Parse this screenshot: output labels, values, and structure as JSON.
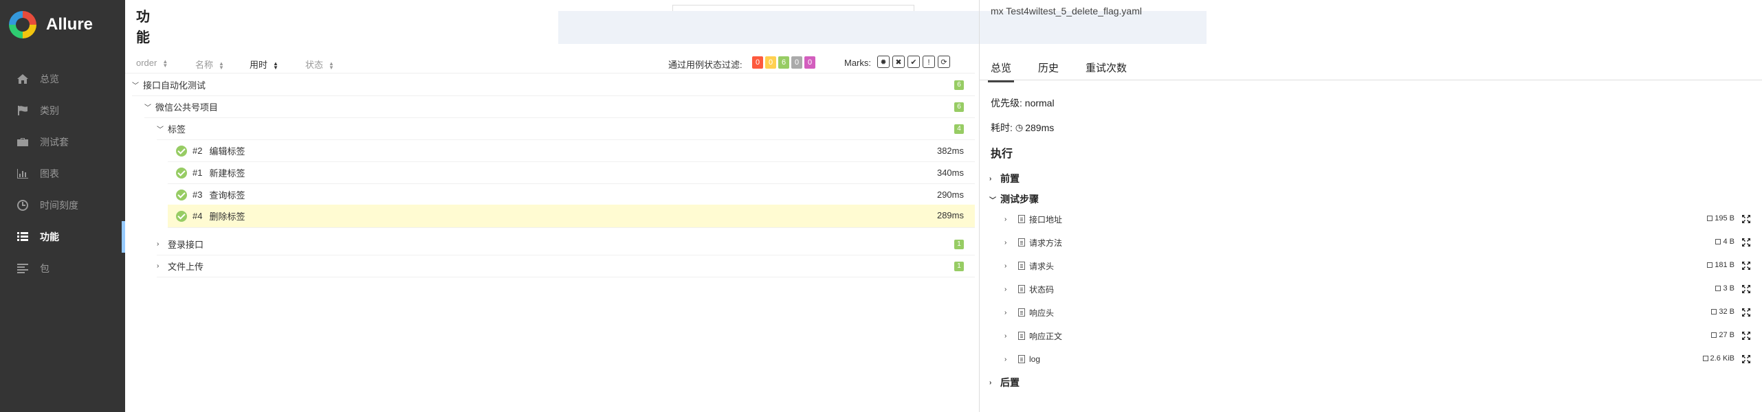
{
  "app": {
    "name": "Allure"
  },
  "sidebar": {
    "items": [
      {
        "label": "总览",
        "icon": "home-icon"
      },
      {
        "label": "类别",
        "icon": "flag-icon"
      },
      {
        "label": "测试套",
        "icon": "briefcase-icon"
      },
      {
        "label": "图表",
        "icon": "bar-chart-icon"
      },
      {
        "label": "时间刻度",
        "icon": "clock-icon"
      },
      {
        "label": "功能",
        "icon": "list-icon",
        "active": true
      },
      {
        "label": "包",
        "icon": "align-left-icon"
      }
    ]
  },
  "main": {
    "title": "功能",
    "sort": {
      "order": "order",
      "name": "名称",
      "duration": "用时",
      "status": "状态"
    },
    "filter_label": "通过用例状态过滤:",
    "status_counts": [
      {
        "value": "0",
        "color": "#fd5a3e"
      },
      {
        "value": "0",
        "color": "#ffd050"
      },
      {
        "value": "6",
        "color": "#97cc64"
      },
      {
        "value": "0",
        "color": "#aaaaaa"
      },
      {
        "value": "0",
        "color": "#d35ebe"
      }
    ],
    "marks_label": "Marks:",
    "tree": {
      "root": {
        "label": "接口自动化测试",
        "count": "6"
      },
      "project": {
        "label": "微信公共号项目",
        "count": "6"
      },
      "group": {
        "label": "标签",
        "count": "4"
      },
      "cases": [
        {
          "num": "#2",
          "name": "编辑标签",
          "duration": "382ms"
        },
        {
          "num": "#1",
          "name": "新建标签",
          "duration": "340ms"
        },
        {
          "num": "#3",
          "name": "查询标签",
          "duration": "290ms"
        },
        {
          "num": "#4",
          "name": "删除标签",
          "duration": "289ms"
        }
      ],
      "others": [
        {
          "label": "登录接口",
          "count": "1"
        },
        {
          "label": "文件上传",
          "count": "1"
        }
      ]
    }
  },
  "detail": {
    "header_fragment": "mx Test4wiltest_5_delete_flag.yaml",
    "tabs": [
      "总览",
      "历史",
      "重试次数"
    ],
    "priority": "优先级: normal",
    "duration_label": "耗时:",
    "duration_value": "289ms",
    "execution_title": "执行",
    "setup": "前置",
    "steps_title": "测试步骤",
    "steps": [
      {
        "name": "接口地址",
        "size": "195 B"
      },
      {
        "name": "请求方法",
        "size": "4 B"
      },
      {
        "name": "请求头",
        "size": "181 B"
      },
      {
        "name": "状态码",
        "size": "3 B"
      },
      {
        "name": "响应头",
        "size": "32 B"
      },
      {
        "name": "响应正文",
        "size": "27 B"
      },
      {
        "name": "log",
        "size": "2.6 KiB"
      }
    ],
    "teardown": "后置"
  }
}
